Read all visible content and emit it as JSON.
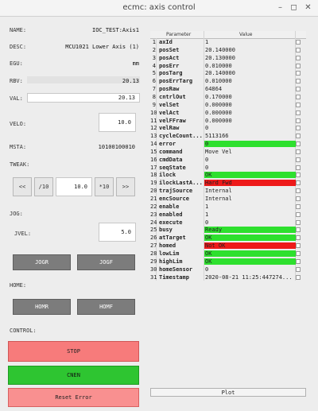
{
  "window": {
    "title": "ecmc: axis control"
  },
  "fields": {
    "name_label": "NAME:",
    "name_value": "IOC_TEST:Axis1",
    "desc_label": "DESC:",
    "desc_value": "MCU1021 Lower Axis (1)",
    "egu_label": "EGU:",
    "egu_value": "mm",
    "rbv_label": "RBV:",
    "rbv_value": "20.13",
    "val_label": "VAL:",
    "val_value": "20.13",
    "velo_label": "VELO:",
    "velo_value": "10.0",
    "msta_label": "MSTA:",
    "msta_value": "10100100010",
    "tweak_label": "TWEAK:",
    "tweak_value": "10.0",
    "jog_label": "JOG:",
    "jvel_label": "JVEL:",
    "jvel_value": "5.0",
    "home_label": "HOME:",
    "control_label": "CONTROL:"
  },
  "buttons": {
    "twk_rev": "<<",
    "twk_div": "/10",
    "twk_mul": "*10",
    "twk_fwd": ">>",
    "jogr": "JOGR",
    "jogf": "JOGF",
    "homr": "HOMR",
    "homf": "HOMF",
    "stop": "STOP",
    "cnen": "CNEN",
    "reset": "Reset Error",
    "plot": "Plot"
  },
  "table": {
    "header_param": "Parameter",
    "header_value": "Value",
    "rows": [
      {
        "n": "1",
        "p": "axId",
        "v": "1",
        "s": ""
      },
      {
        "n": "2",
        "p": "posSet",
        "v": "20.140000",
        "s": ""
      },
      {
        "n": "3",
        "p": "posAct",
        "v": "20.130000",
        "s": ""
      },
      {
        "n": "4",
        "p": "posErr",
        "v": "0.010000",
        "s": ""
      },
      {
        "n": "5",
        "p": "posTarg",
        "v": "20.140000",
        "s": ""
      },
      {
        "n": "6",
        "p": "posErrTarg",
        "v": "0.010000",
        "s": ""
      },
      {
        "n": "7",
        "p": "posRaw",
        "v": "64864",
        "s": ""
      },
      {
        "n": "8",
        "p": "cntrlOut",
        "v": "0.170000",
        "s": ""
      },
      {
        "n": "9",
        "p": "velSet",
        "v": "0.000000",
        "s": ""
      },
      {
        "n": "10",
        "p": "velAct",
        "v": "0.000000",
        "s": ""
      },
      {
        "n": "11",
        "p": "velFFraw",
        "v": "0.000000",
        "s": ""
      },
      {
        "n": "12",
        "p": "velRaw",
        "v": "0",
        "s": ""
      },
      {
        "n": "13",
        "p": "cycleCount...",
        "v": "5113166",
        "s": ""
      },
      {
        "n": "14",
        "p": "error",
        "v": "0",
        "s": "green"
      },
      {
        "n": "15",
        "p": "command",
        "v": "Move Vel",
        "s": ""
      },
      {
        "n": "16",
        "p": "cmdData",
        "v": "0",
        "s": ""
      },
      {
        "n": "17",
        "p": "seqState",
        "v": "0",
        "s": ""
      },
      {
        "n": "18",
        "p": "ilock",
        "v": "OK",
        "s": "green"
      },
      {
        "n": "19",
        "p": "ilockLastA...",
        "v": "Hard Fwd",
        "s": "red"
      },
      {
        "n": "20",
        "p": "trajSource",
        "v": "Internal",
        "s": ""
      },
      {
        "n": "21",
        "p": "encSource",
        "v": "Internal",
        "s": ""
      },
      {
        "n": "22",
        "p": "enable",
        "v": "1",
        "s": ""
      },
      {
        "n": "23",
        "p": "enabled",
        "v": "1",
        "s": ""
      },
      {
        "n": "24",
        "p": "execute",
        "v": "0",
        "s": ""
      },
      {
        "n": "25",
        "p": "busy",
        "v": "Ready",
        "s": "green"
      },
      {
        "n": "26",
        "p": "atTarget",
        "v": "OK",
        "s": "green"
      },
      {
        "n": "27",
        "p": "homed",
        "v": "Not OK",
        "s": "red"
      },
      {
        "n": "28",
        "p": "lowLim",
        "v": "OK",
        "s": "green"
      },
      {
        "n": "29",
        "p": "highLim",
        "v": "OK",
        "s": "green"
      },
      {
        "n": "30",
        "p": "homeSensor",
        "v": "0",
        "s": ""
      },
      {
        "n": "31",
        "p": "Timestamp",
        "v": "2020-08-21 11:25:447274...",
        "s": ""
      }
    ]
  },
  "colors": {
    "ok": "#2ee02e",
    "fault": "#ee1a1a",
    "stop": "#f77b7b",
    "cnen": "#2ec531"
  }
}
